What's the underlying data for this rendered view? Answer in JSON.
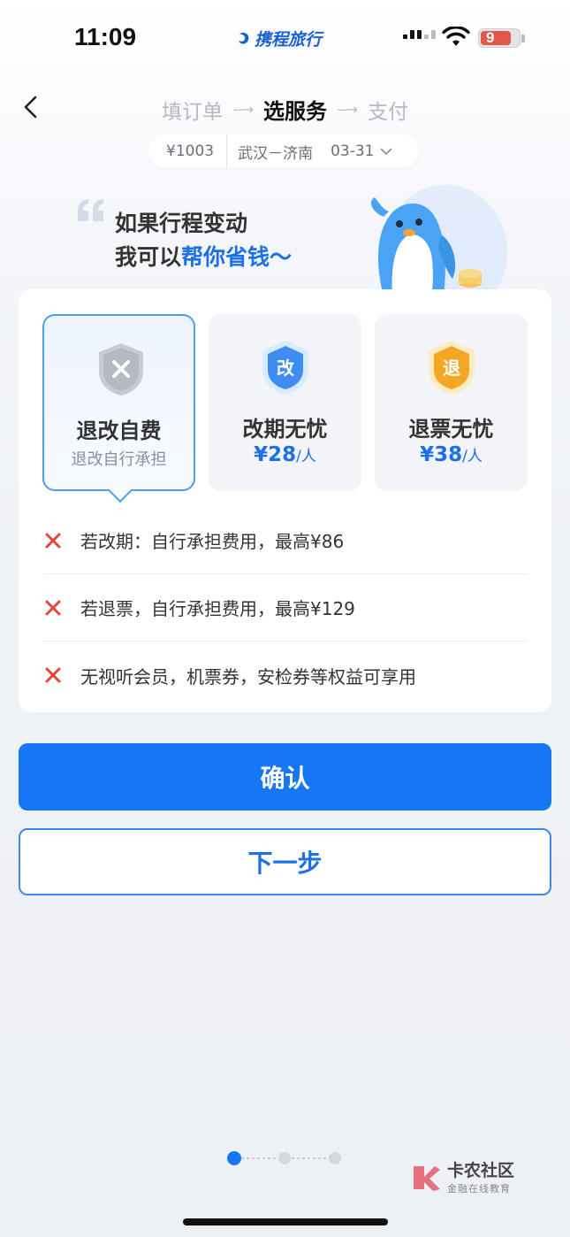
{
  "status_bar": {
    "time": "11:09",
    "carrier": "携程旅行",
    "battery": "9"
  },
  "steps": {
    "step1": "填订单",
    "step2": "选服务",
    "step3": "支付",
    "arrow": "--→"
  },
  "trip": {
    "price": "¥1003",
    "route": "武汉－济南",
    "date": "03-31"
  },
  "promo": {
    "line1": "如果行程变动",
    "line2_prefix": "我可以",
    "line2_highlight": "帮你省钱～"
  },
  "options": [
    {
      "icon": "x-shield-icon",
      "icon_char": "×",
      "title": "退改自费",
      "subtitle": "退改自行承担",
      "selected": true
    },
    {
      "icon": "change-shield-icon",
      "icon_char": "改",
      "title": "改期无忧",
      "price": "¥28",
      "unit": "/人",
      "selected": false
    },
    {
      "icon": "refund-shield-icon",
      "icon_char": "退",
      "title": "退票无忧",
      "price": "¥38",
      "unit": "/人",
      "selected": false
    }
  ],
  "features": [
    "若改期：自行承担费用，最高¥86",
    "若退票，自行承担费用，最高¥129",
    "无视听会员，机票券，安检券等权益可享用"
  ],
  "buttons": {
    "confirm": "确认",
    "next": "下一步"
  },
  "pager": {
    "count": 3,
    "active": 1
  },
  "watermark": {
    "title": "卡农社区",
    "subtitle": "金融在线教育"
  },
  "colors": {
    "primary": "#1677f4",
    "highlight": "#1b6fe8",
    "cross": "#e2463d"
  }
}
